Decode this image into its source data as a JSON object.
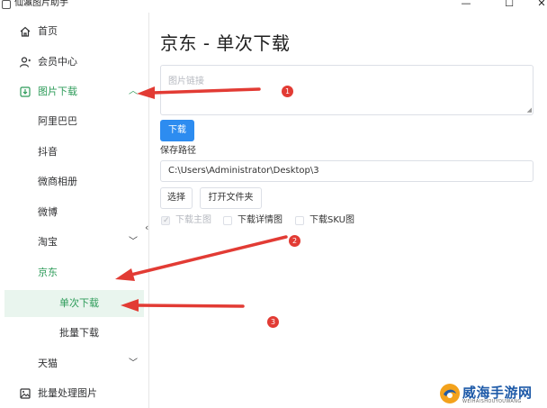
{
  "window": {
    "title": "仙瀛图片助手",
    "minimize_glyph": "—",
    "maximize_glyph": "☐",
    "close_glyph": "✕"
  },
  "sidebar": {
    "items": [
      {
        "label": "首页",
        "icon": "home-icon"
      },
      {
        "label": "会员中心",
        "icon": "user-icon"
      },
      {
        "label": "图片下载",
        "icon": "download-icon"
      },
      {
        "label": "阿里巴巴"
      },
      {
        "label": "抖音"
      },
      {
        "label": "微商相册"
      },
      {
        "label": "微博"
      },
      {
        "label": "淘宝"
      },
      {
        "label": "京东"
      },
      {
        "label": "单次下载"
      },
      {
        "label": "批量下载"
      },
      {
        "label": "天猫"
      },
      {
        "label": "批量处理图片",
        "icon": "image-icon"
      }
    ],
    "collapse_glyph": "‹"
  },
  "main": {
    "title": "京东 - 单次下载",
    "url_placeholder": "图片链接",
    "download_label": "下载",
    "save_path_label": "保存路径",
    "save_path_value": "C:\\Users\\Administrator\\Desktop\\3",
    "choose_label": "选择",
    "open_folder_label": "打开文件夹",
    "checkboxes": [
      {
        "label": "下载主图",
        "checked": true,
        "disabled": true
      },
      {
        "label": "下载详情图",
        "checked": false
      },
      {
        "label": "下载SKU图",
        "checked": false
      }
    ]
  },
  "annotations": {
    "badges": [
      "1",
      "2",
      "3"
    ],
    "color": "#e23b34"
  },
  "watermark": {
    "text": "威海手游网",
    "sub": "WEIHAISHOUYOUWANG"
  },
  "colors": {
    "accent_green": "#2d9b59",
    "primary_blue": "#2d8cf0",
    "annotation_red": "#e23b34"
  }
}
